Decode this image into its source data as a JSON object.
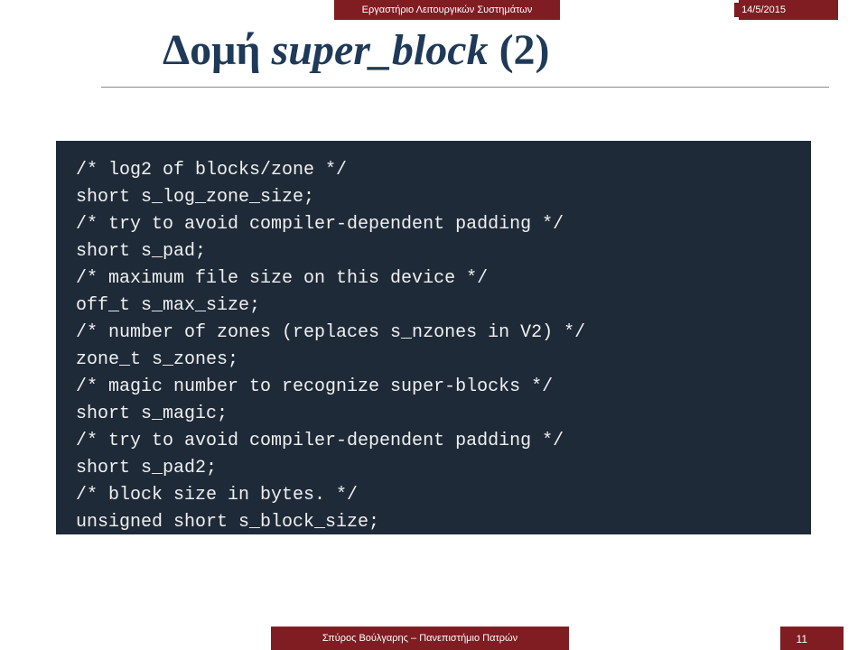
{
  "header": {
    "lab": "Εργαστήριο Λειτουργικών Συστημάτων",
    "date": "14/5/2015"
  },
  "title": {
    "prefix": "Δομή ",
    "italic": "super_block",
    "suffix": " (2)"
  },
  "code": {
    "l1": "/* log2 of blocks/zone */",
    "l2": "short s_log_zone_size;",
    "l3": "/* try to avoid compiler-dependent padding */",
    "l4": "short s_pad;",
    "l5": "/* maximum file size on this device */",
    "l6": "off_t s_max_size;",
    "l7": "/* number of zones (replaces s_nzones in V2) */",
    "l8": "zone_t s_zones;",
    "l9": "/* magic number to recognize super-blocks */",
    "l10": "short s_magic;",
    "l11": "/* try to avoid compiler-dependent padding */",
    "l12": "short s_pad2;",
    "l13": "/* block size in bytes. */",
    "l14": "unsigned short s_block_size;"
  },
  "footer": {
    "author": "Σπύρος Βούλγαρης – Πανεπιστήμιο Πατρών",
    "page": "11"
  }
}
